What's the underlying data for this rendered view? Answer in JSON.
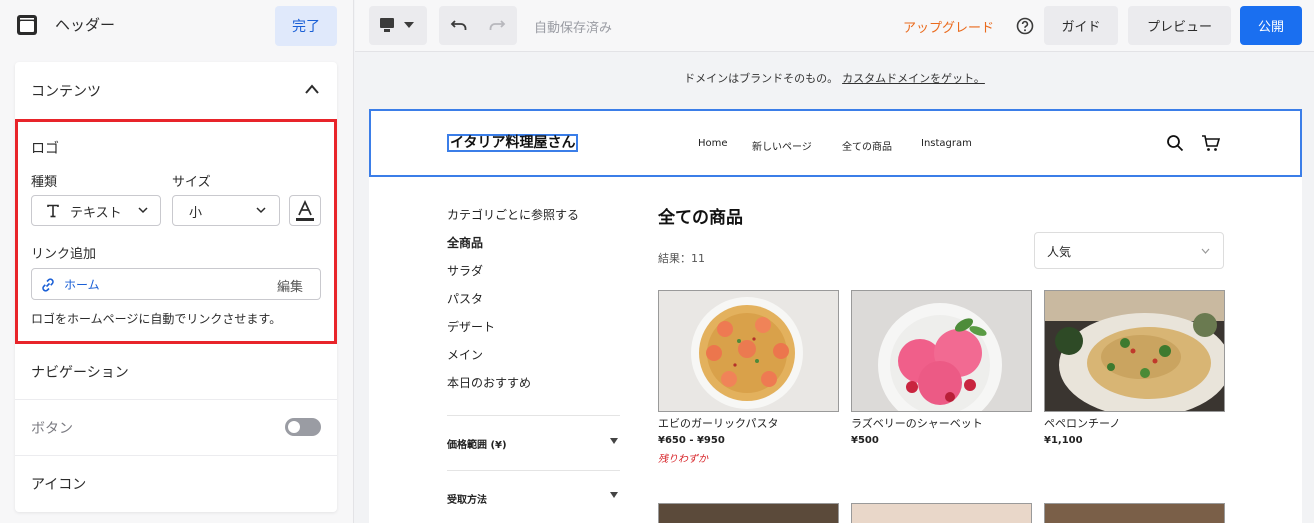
{
  "left_panel": {
    "header_title": "ヘッダー",
    "done_label": "完了",
    "contents": {
      "title": "コンテンツ",
      "logo": {
        "title": "ロゴ",
        "type_label": "種類",
        "type_value": "テキスト",
        "size_label": "サイズ",
        "size_value": "小",
        "link_label": "リンク追加",
        "link_value": "ホーム",
        "link_edit": "編集",
        "hint": "ロゴをホームページに自動でリンクさせます。"
      },
      "navigation_label": "ナビゲーション",
      "button_label": "ボタン",
      "button_toggle_on": false,
      "icon_label": "アイコン"
    }
  },
  "toolbar": {
    "autosave": "自動保存済み",
    "upgrade": "アップグレード",
    "guide": "ガイド",
    "preview": "プレビュー",
    "publish": "公開"
  },
  "banner": {
    "text": "ドメインはブランドそのもの。",
    "cta": "カスタムドメインをゲット。"
  },
  "site": {
    "logo_text": "イタリア料理屋さん",
    "nav": [
      "Home",
      "新しいページ",
      "全ての商品",
      "Instagram"
    ],
    "category_heading": "カテゴリごとに参照する",
    "categories": [
      "全商品",
      "サラダ",
      "パスタ",
      "デザート",
      "メイン",
      "本日のおすすめ"
    ],
    "filters": [
      "価格範囲 (¥)",
      "受取方法"
    ],
    "page_title": "全ての商品",
    "results": "結果：11",
    "sort_value": "人気",
    "products": [
      {
        "name": "エビのガーリックパスタ",
        "price": "¥650 - ¥950",
        "stock": "残りわずか"
      },
      {
        "name": "ラズベリーのシャーベット",
        "price": "¥500",
        "stock": ""
      },
      {
        "name": "ペペロンチーノ",
        "price": "¥1,100",
        "stock": ""
      }
    ]
  },
  "colors": {
    "accent": "#1a6ff0",
    "selection_outline": "#3b7ee8",
    "highlight_box": "#e8242a",
    "upgrade": "#ea6a1c",
    "low_stock": "#d8262b"
  }
}
